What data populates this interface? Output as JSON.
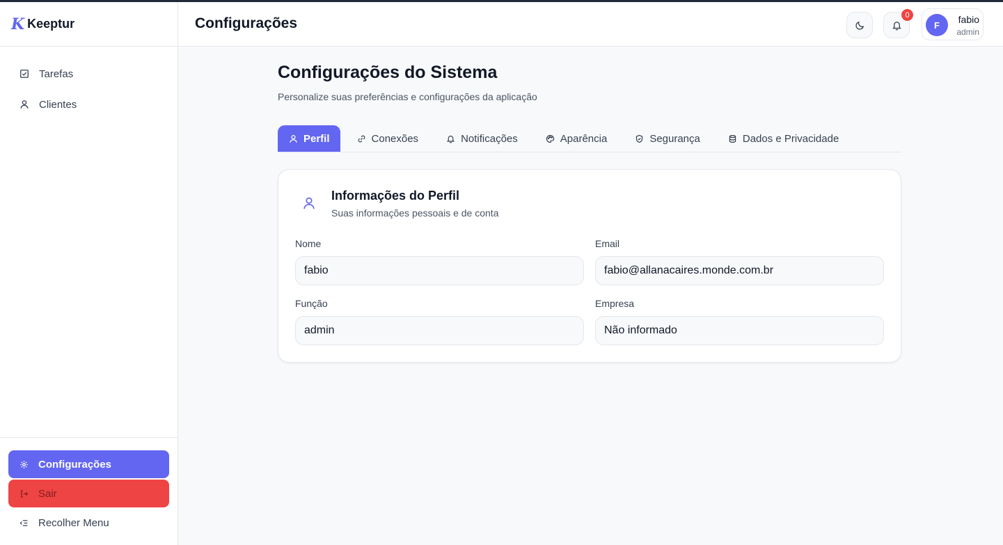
{
  "brand": {
    "logo": "K",
    "name": "Keeptur"
  },
  "sidebar": {
    "items": [
      {
        "label": "Tarefas",
        "icon": "checkbox-icon"
      },
      {
        "label": "Clientes",
        "icon": "user-icon"
      }
    ],
    "bottom": {
      "settings_label": "Configurações",
      "logout_label": "Sair",
      "collapse_label": "Recolher Menu"
    }
  },
  "header": {
    "title": "Configurações",
    "notification_count": "0",
    "user": {
      "initial": "F",
      "name": "fabio",
      "role": "admin"
    }
  },
  "main": {
    "title": "Configurações do Sistema",
    "subtitle": "Personalize suas preferências e configurações da aplicação",
    "tabs": [
      {
        "label": "Perfil",
        "icon": "user-icon",
        "active": true
      },
      {
        "label": "Conexões",
        "icon": "link-icon"
      },
      {
        "label": "Notificações",
        "icon": "bell-icon"
      },
      {
        "label": "Aparência",
        "icon": "palette-icon"
      },
      {
        "label": "Segurança",
        "icon": "shield-icon"
      },
      {
        "label": "Dados e Privacidade",
        "icon": "database-icon"
      }
    ],
    "card": {
      "title": "Informações do Perfil",
      "subtitle": "Suas informações pessoais e de conta",
      "fields": {
        "name": {
          "label": "Nome",
          "value": "fabio"
        },
        "email": {
          "label": "Email",
          "value": "fabio@allanacaires.monde.com.br"
        },
        "role": {
          "label": "Função",
          "value": "admin"
        },
        "company": {
          "label": "Empresa",
          "value": "Não informado"
        }
      }
    }
  },
  "colors": {
    "accent": "#6366f1",
    "danger": "#ef4444",
    "background": "#f8f9fb"
  }
}
